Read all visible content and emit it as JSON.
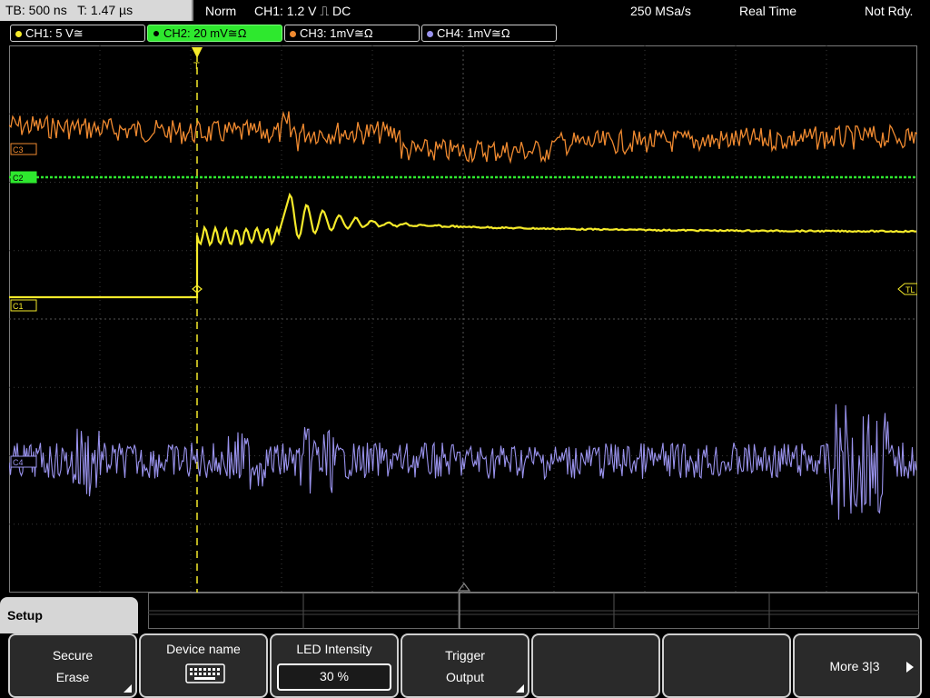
{
  "topbar": {
    "tb": "TB: 500 ns",
    "t": "T: 1.47 µs",
    "mode": "Norm",
    "trigger": "CH1: 1.2 V ⎍ DC",
    "sample_rate": "250 MSa/s",
    "acq": "Real Time",
    "status": "Not Rdy."
  },
  "channels": [
    {
      "label": "CH1: 5 V≅",
      "color": "#f5ea2a"
    },
    {
      "label": "CH2: 20 mV≅Ω",
      "color": "#2ee82e"
    },
    {
      "label": "CH3: 1mV≅Ω",
      "color": "#f08a30"
    },
    {
      "label": "CH4: 1mV≅Ω",
      "color": "#9a93ee"
    }
  ],
  "markers": {
    "c1": "C1",
    "c2": "C2",
    "c3": "C3",
    "c4": "C4",
    "tl": "TL",
    "trigger_pos": "T"
  },
  "menu": {
    "title": "Setup",
    "softkeys": [
      {
        "line1": "Secure",
        "line2": "Erase"
      },
      {
        "line1": "Device name",
        "icon": "keyboard-icon"
      },
      {
        "line1": "LED Intensity",
        "value": "30 %"
      },
      {
        "line1": "Trigger",
        "line2": "Output"
      },
      {
        "line1": ""
      },
      {
        "line1": ""
      },
      {
        "line1": "More 3|3"
      }
    ]
  }
}
